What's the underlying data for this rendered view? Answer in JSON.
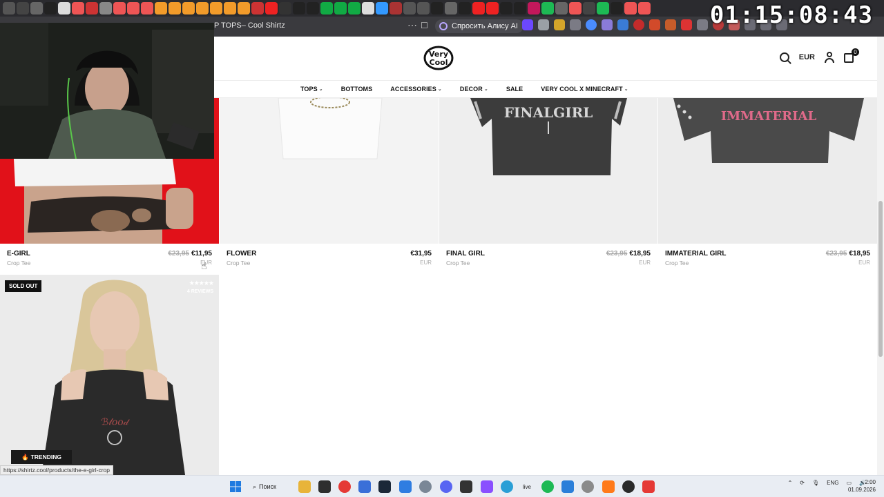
{
  "browser": {
    "tab_title": "P TOPS– Cool Shirtz",
    "alice_button": "Спросить Алису AI",
    "tab_icons": [
      "app",
      "back",
      "dot",
      "x",
      "doc",
      "g",
      "p",
      "dash",
      "g",
      "g",
      "g",
      "fire",
      "fire",
      "fire",
      "fire",
      "fire",
      "fire",
      "fire",
      "globe",
      "yt",
      "bolt",
      "gh",
      "gh",
      "s",
      "s",
      "s",
      "doc",
      "bird",
      "m",
      "active",
      "active",
      "gh",
      "dot",
      "x",
      "yt",
      "yt",
      "gh",
      "gh",
      "star",
      "spot",
      "dot",
      "g",
      "moon",
      "spot",
      "gh",
      "g",
      "g"
    ]
  },
  "timer": "01:15:08:43",
  "site": {
    "currency": "EUR",
    "cart_count": "0",
    "nav": [
      {
        "label": "TOPS",
        "dropdown": true
      },
      {
        "label": "BOTTOMS",
        "dropdown": false
      },
      {
        "label": "ACCESSORIES",
        "dropdown": true
      },
      {
        "label": "DECOR",
        "dropdown": true
      },
      {
        "label": "SALE",
        "dropdown": false
      },
      {
        "label": "VERY COOL X MINECRAFT",
        "dropdown": true
      }
    ]
  },
  "products": [
    {
      "name": "E-GIRL",
      "sub": "Crop Tee",
      "old_price": "€23,95",
      "price": "€11,95",
      "currency": "EUR"
    },
    {
      "name": "FLOWER",
      "sub": "Crop Tee",
      "old_price": "",
      "price": "€31,95",
      "currency": "EUR"
    },
    {
      "name": "FINAL GIRL",
      "sub": "Crop Tee",
      "old_price": "€23,95",
      "price": "€18,95",
      "currency": "EUR"
    },
    {
      "name": "IMMATERIAL GIRL",
      "sub": "Crop Tee",
      "old_price": "€23,95",
      "price": "€18,95",
      "currency": "EUR"
    }
  ],
  "product5": {
    "badge": "SOLD OUT",
    "stars": "★★★★★",
    "reviews": "4 REVIEWS"
  },
  "trending": "TRENDING",
  "status_url": "https://shirtz.cool/products/the-e-girl-crop",
  "taskbar": {
    "search": "Поиск",
    "lang": "ENG",
    "time": "2:00",
    "date": "01.09.2026",
    "spotify_badge": "",
    "live": "live"
  }
}
